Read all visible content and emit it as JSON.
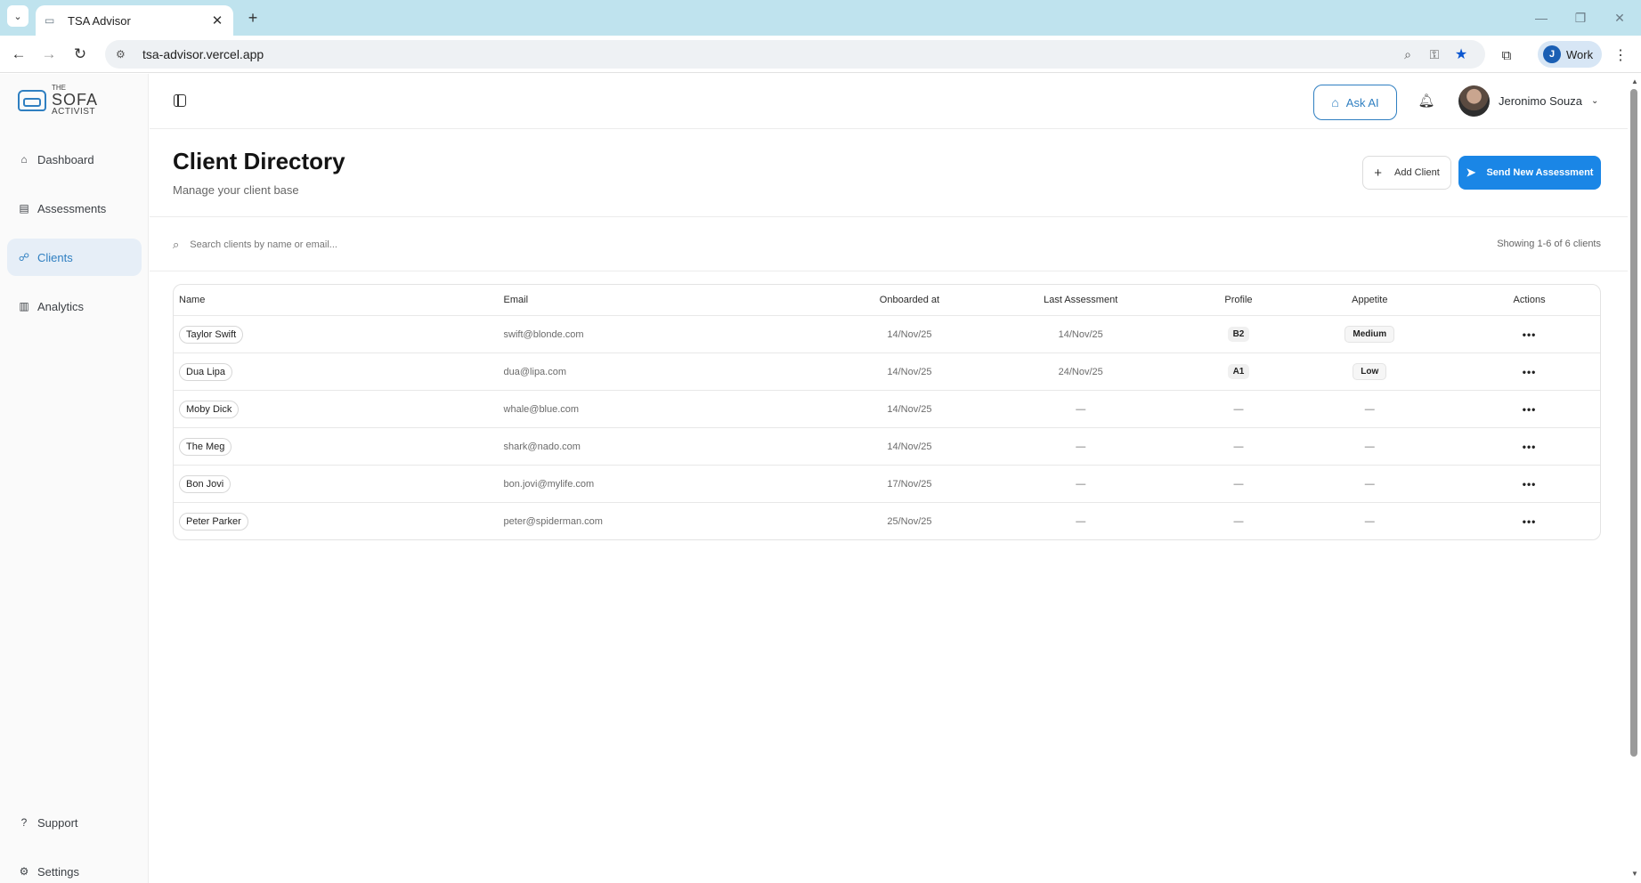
{
  "browser": {
    "tab_title": "TSA Advisor",
    "url": "tsa-advisor.vercel.app",
    "profile_label": "Work",
    "profile_initial": "J"
  },
  "sidebar": {
    "logo": {
      "the": "THE",
      "brand": "SOFA",
      "sub": "ACTIVIST"
    },
    "items": [
      {
        "label": "Dashboard",
        "icon": "home-icon",
        "active": false
      },
      {
        "label": "Assessments",
        "icon": "document-icon",
        "active": false
      },
      {
        "label": "Clients",
        "icon": "users-icon",
        "active": true
      },
      {
        "label": "Analytics",
        "icon": "bar-chart-icon",
        "active": false
      }
    ],
    "footer": [
      {
        "label": "Support",
        "icon": "help-circle-icon"
      },
      {
        "label": "Settings",
        "icon": "gear-icon"
      }
    ]
  },
  "topbar": {
    "ask_ai_label": "Ask AI",
    "user_name": "Jeronimo Souza"
  },
  "page": {
    "title": "Client Directory",
    "subtitle": "Manage your client base",
    "add_client_label": "Add Client",
    "send_assessment_label": "Send New Assessment",
    "search_placeholder": "Search clients by name or email...",
    "showing_text": "Showing 1-6 of 6 clients"
  },
  "table": {
    "columns": [
      "Name",
      "Email",
      "Onboarded at",
      "Last Assessment",
      "Profile",
      "Appetite",
      "Actions"
    ],
    "rows": [
      {
        "name": "Taylor Swift",
        "email": "swift@blonde.com",
        "onboarded": "14/Nov/25",
        "last": "14/Nov/25",
        "profile": "B2",
        "appetite": "Medium"
      },
      {
        "name": "Dua Lipa",
        "email": "dua@lipa.com",
        "onboarded": "14/Nov/25",
        "last": "24/Nov/25",
        "profile": "A1",
        "appetite": "Low"
      },
      {
        "name": "Moby Dick",
        "email": "whale@blue.com",
        "onboarded": "14/Nov/25",
        "last": "—",
        "profile": "—",
        "appetite": "—"
      },
      {
        "name": "The Meg",
        "email": "shark@nado.com",
        "onboarded": "14/Nov/25",
        "last": "—",
        "profile": "—",
        "appetite": "—"
      },
      {
        "name": "Bon Jovi",
        "email": "bon.jovi@mylife.com",
        "onboarded": "17/Nov/25",
        "last": "—",
        "profile": "—",
        "appetite": "—"
      },
      {
        "name": "Peter Parker",
        "email": "peter@spiderman.com",
        "onboarded": "25/Nov/25",
        "last": "—",
        "profile": "—",
        "appetite": "—"
      }
    ],
    "actions_glyph": "•••"
  },
  "colors": {
    "accent": "#1a86e6",
    "brand": "#2f7fc1",
    "active_nav_bg": "#e6eef7"
  }
}
